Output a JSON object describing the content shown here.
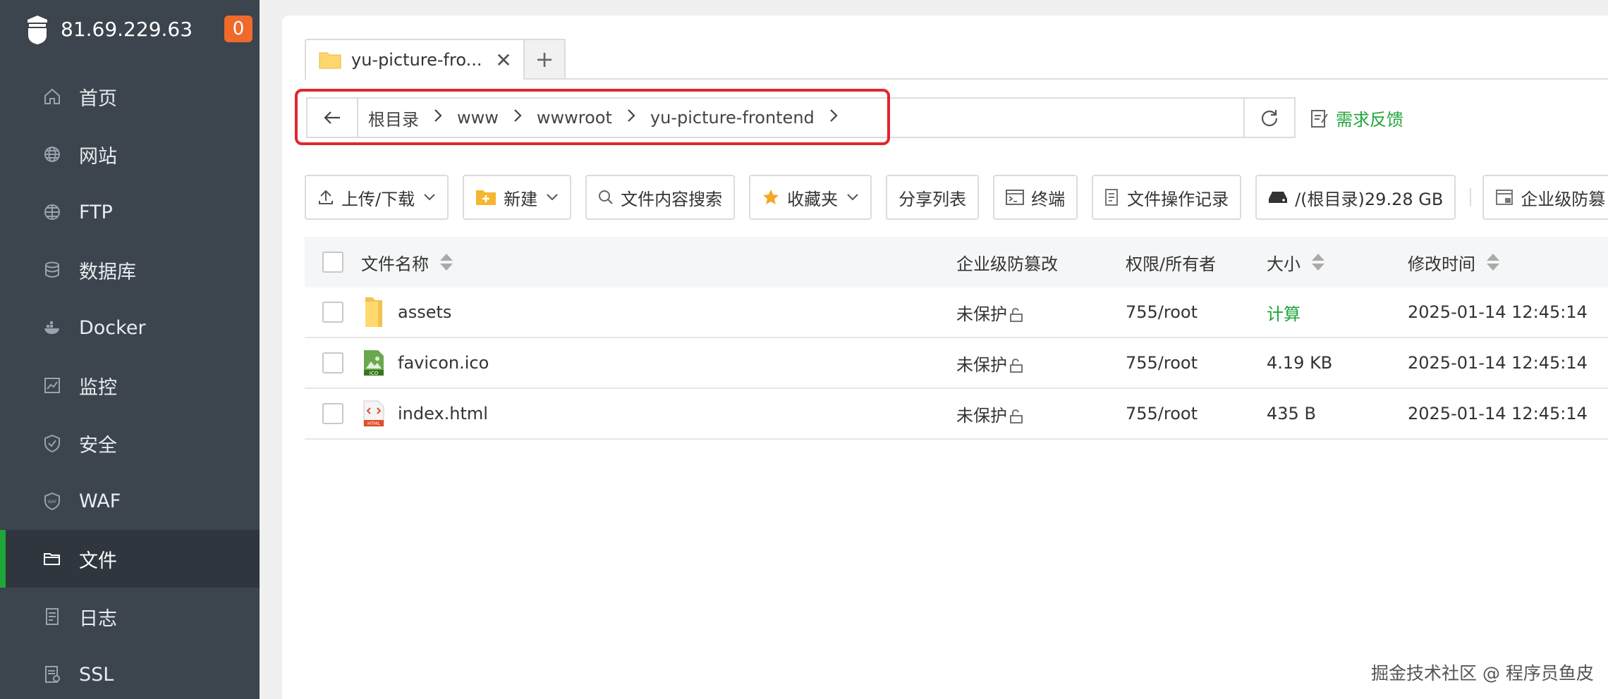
{
  "server": {
    "ip": "81.69.229.63",
    "badge": "0"
  },
  "sidebar": {
    "items": [
      {
        "label": "首页",
        "icon": "home-icon"
      },
      {
        "label": "网站",
        "icon": "globe-icon"
      },
      {
        "label": "FTP",
        "icon": "ftp-icon"
      },
      {
        "label": "数据库",
        "icon": "database-icon"
      },
      {
        "label": "Docker",
        "icon": "docker-icon"
      },
      {
        "label": "监控",
        "icon": "monitor-icon"
      },
      {
        "label": "安全",
        "icon": "shield-icon"
      },
      {
        "label": "WAF",
        "icon": "waf-icon"
      },
      {
        "label": "文件",
        "icon": "folder-icon",
        "active": true
      },
      {
        "label": "日志",
        "icon": "log-icon"
      },
      {
        "label": "SSL",
        "icon": "ssl-icon"
      }
    ]
  },
  "tabs": [
    {
      "label": "yu-picture-fro...",
      "close": "✕"
    }
  ],
  "tab_add": "+",
  "address": {
    "crumbs": [
      "根目录",
      "www",
      "wwwroot",
      "yu-picture-frontend"
    ]
  },
  "feedback_label": "需求反馈",
  "toolbar": {
    "upload": "上传/下载",
    "new": "新建",
    "search": "文件内容搜索",
    "favorites": "收藏夹",
    "share": "分享列表",
    "terminal": "终端",
    "oplog": "文件操作记录",
    "disk": "/(根目录)29.28 GB",
    "tamper": "企业级防篡"
  },
  "table": {
    "headers": {
      "name": "文件名称",
      "protect": "企业级防篡改",
      "perm": "权限/所有者",
      "size": "大小",
      "time": "修改时间"
    },
    "rows": [
      {
        "name": "assets",
        "type": "folder",
        "protect": "未保护",
        "perm": "755/root",
        "size": "计算",
        "size_is_link": true,
        "time": "2025-01-14 12:45:14"
      },
      {
        "name": "favicon.ico",
        "type": "ico",
        "protect": "未保护",
        "perm": "755/root",
        "size": "4.19 KB",
        "time": "2025-01-14 12:45:14"
      },
      {
        "name": "index.html",
        "type": "html",
        "protect": "未保护",
        "perm": "755/root",
        "size": "435 B",
        "time": "2025-01-14 12:45:14"
      }
    ]
  },
  "watermark": "掘金技术社区 @ 程序员鱼皮",
  "colors": {
    "sidebar": "#3c444d",
    "accent": "#20a53a",
    "badge": "#ef6a2b",
    "highlight": "#e0262d"
  }
}
